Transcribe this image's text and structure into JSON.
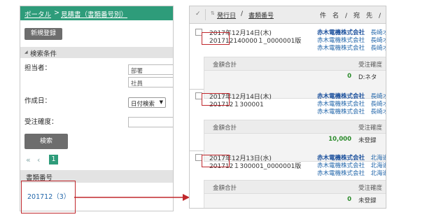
{
  "left": {
    "breadcrumb_portal": "ポータル",
    "breadcrumb_sep": ">",
    "breadcrumb_page": "見積書（書類番号別）",
    "new_button": "新規登録",
    "search_section": "検索条件",
    "assignee_label": "担当者：",
    "dept_placeholder": "部署",
    "staff_placeholder": "社員",
    "created_label": "作成日：",
    "date_select": "日付検索",
    "order_label": "受注確度：",
    "search_button": "検索",
    "pager_first": "«",
    "pager_prev": "‹",
    "pager_current": "1",
    "doc_header": "書類番号",
    "doc_item": "201712（3）"
  },
  "right": {
    "header_date": "発行日",
    "header_sep": "/",
    "header_docno": "書類番号",
    "header_subject": "件　名　/　宛　先　/　案",
    "records": [
      {
        "date": "2017年12月14日(木)",
        "docno": "201712140000１_0000001版",
        "company_bold": "赤木電機株式会社",
        "company_bold_suffix": "長崎オ",
        "company_2": "赤木電機株式会社　長崎オフ",
        "company_3": "赤木電機株式会社　長崎オフ",
        "amount_label": "金額合計",
        "order_label": "受注確度",
        "amount": "0",
        "order_value": "D:ネタ"
      },
      {
        "date": "2017年12月14日(木)",
        "docno": "201712１300001",
        "company_bold": "赤木電機株式会社",
        "company_bold_suffix": "長崎オ",
        "company_2": "赤木電機株式会社　長崎オ",
        "company_3": "赤木電機株式会社　長崎オ",
        "amount_label": "金額合計",
        "order_label": "受注確度",
        "amount": "10,000",
        "order_value": "未登録"
      },
      {
        "date": "2017年12月13日(水)",
        "docno": "201712１300001_0000001版",
        "company_bold": "赤木電機株式会社",
        "company_bold_suffix": "北海道",
        "company_2": "赤木電機株式会社　北海道ノ",
        "company_3": "赤木電機株式会社　北海道ノ",
        "amount_label": "金額合計",
        "order_label": "受注確度",
        "amount": "0",
        "order_value": "未登録"
      }
    ]
  },
  "colors": {
    "header_green": "#2e9c7a",
    "highlight_red": "#c0282d",
    "link_blue": "#2266aa",
    "amount_green": "#2a8a2a"
  },
  "icons": [
    "checkbox-icon",
    "sort-icon",
    "arrow-right-icon",
    "triangle-icon",
    "dropdown-arrow-icon"
  ]
}
